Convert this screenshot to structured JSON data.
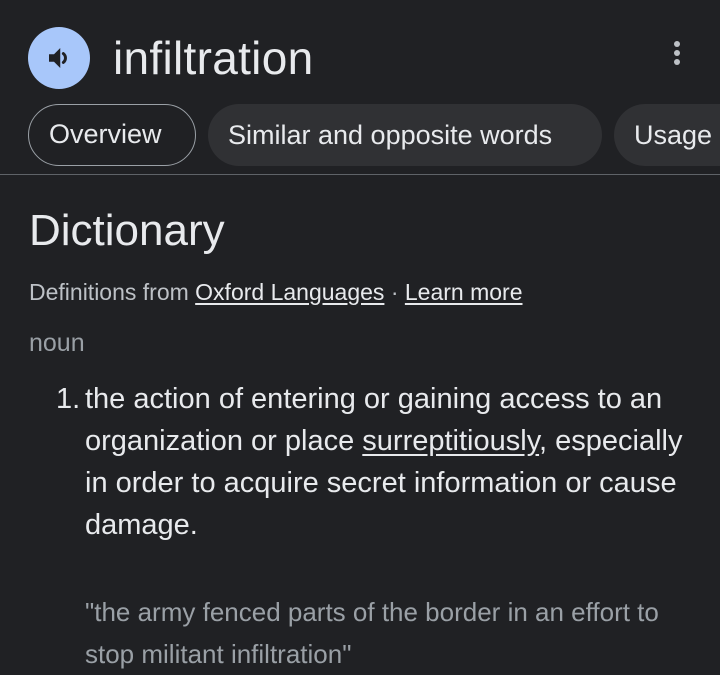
{
  "header": {
    "speaker_icon": "speaker-icon",
    "word": "infiltration",
    "menu_icon": "more-vert-icon"
  },
  "tabs": [
    {
      "label": "Overview",
      "active": true
    },
    {
      "label": "Similar and opposite words",
      "active": false
    },
    {
      "label": "Usage",
      "active": false
    }
  ],
  "dictionary": {
    "title": "Dictionary",
    "source_prefix": "Definitions from",
    "source_link": "Oxford Languages",
    "separator": "·",
    "learn_more": "Learn more",
    "part_of_speech": "noun",
    "definitions": [
      {
        "number": "1.",
        "text_before": "the action of entering or gaining access to an organization or place",
        "linked_word": "surreptitiously",
        "text_after": ", especially in order to acquire secret information or cause damage.",
        "example": "\"the army fenced parts of the border in an effort to stop militant infiltration\""
      }
    ]
  },
  "colors": {
    "background": "#202124",
    "accent": "#a8c7fa",
    "chip": "#303134",
    "text": "#e8eaed",
    "muted": "#9aa0a6"
  }
}
